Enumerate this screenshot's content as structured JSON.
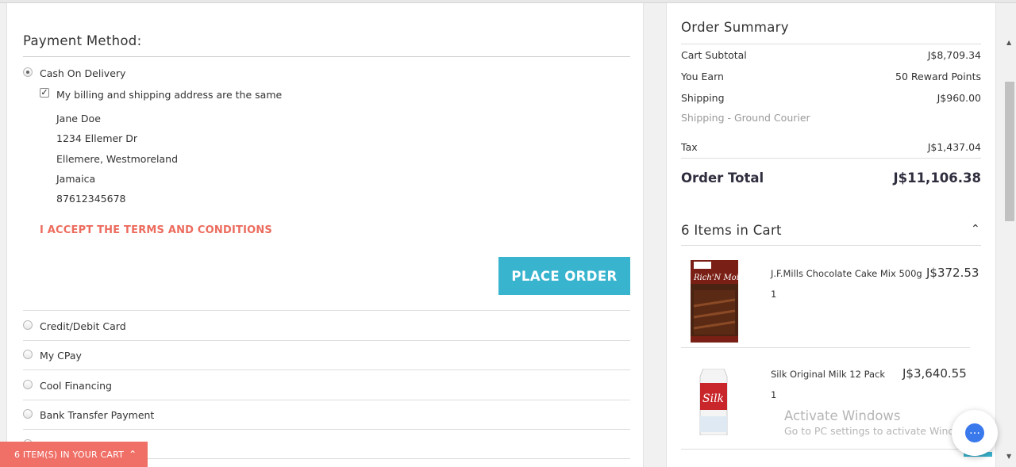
{
  "payment": {
    "title": "Payment Method:",
    "cash_option": "Cash On Delivery",
    "billing_same": "My billing and shipping address are the same",
    "address": [
      "Jane Doe",
      "1234 Ellemer Dr",
      "Ellemere, Westmoreland",
      "Jamaica",
      "87612345678"
    ],
    "terms": "I ACCEPT THE TERMS AND CONDITIONS",
    "place_order": "PLACE ORDER",
    "other_options": [
      "Credit/Debit Card",
      "My CPay",
      "Cool Financing",
      "Bank Transfer Payment"
    ]
  },
  "summary": {
    "title": "Order Summary",
    "subtotal_label": "Cart Subtotal",
    "subtotal_value": "J$8,709.34",
    "earn_label": "You Earn",
    "earn_value": "50 Reward Points",
    "shipping_label": "Shipping",
    "shipping_value": "J$960.00",
    "shipping_method": "Shipping - Ground Courier",
    "tax_label": "Tax",
    "tax_value": "J$1,437.04",
    "total_label": "Order Total",
    "total_value": "J$11,106.38"
  },
  "cart": {
    "title": "6 Items in Cart",
    "items": [
      {
        "name": "J.F.Mills Chocolate Cake Mix 500g",
        "price": "J$372.53",
        "qty": "1"
      },
      {
        "name": "Silk Original Milk 12 Pack",
        "price": "J$3,640.55",
        "qty": "1"
      }
    ],
    "footer_bar": "6 ITEM(S) IN YOUR CART"
  },
  "overlay": {
    "activate_title": "Activate Windows",
    "activate_sub": "Go to PC settings to activate Windows."
  },
  "colors": {
    "accent": "#39b4cf",
    "terms": "#ec6c5e",
    "cart_bar": "#f07067",
    "chat": "#3a79ec"
  }
}
